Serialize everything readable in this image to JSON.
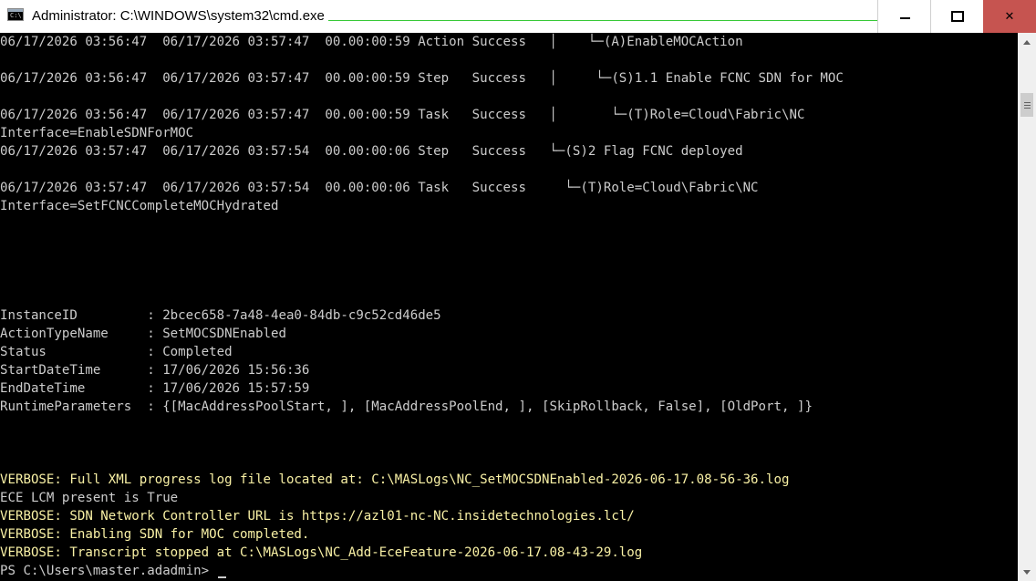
{
  "window": {
    "title": "Administrator: C:\\WINDOWS\\system32\\cmd.exe",
    "icon": "cmd-console-icon",
    "controls": {
      "minimize": "minimize-icon",
      "maximize": "maximize-icon",
      "close": "✕"
    },
    "close_color": "#c65450"
  },
  "colors": {
    "background": "#000000",
    "text": "#cccccc",
    "verbose": "#f9f1a5"
  },
  "console": {
    "lines": [
      "06/17/2026 03:56:47  06/17/2026 03:57:47  00.00:00:59 Action Success   │    └─(A)EnableMOCAction",
      "",
      "06/17/2026 03:56:47  06/17/2026 03:57:47  00.00:00:59 Step   Success   │     └─(S)1.1 Enable FCNC SDN for MOC",
      "",
      "06/17/2026 03:56:47  06/17/2026 03:57:47  00.00:00:59 Task   Success   │       └─(T)Role=Cloud\\Fabric\\NC",
      "Interface=EnableSDNForMOC",
      "06/17/2026 03:57:47  06/17/2026 03:57:54  00.00:00:06 Step   Success   └─(S)2 Flag FCNC deployed",
      "",
      "06/17/2026 03:57:47  06/17/2026 03:57:54  00.00:00:06 Task   Success     └─(T)Role=Cloud\\Fabric\\NC",
      "Interface=SetFCNCCompleteMOCHydrated",
      "",
      "",
      "",
      "",
      "",
      "InstanceID         : 2bcec658-7a48-4ea0-84db-c9c52cd46de5",
      "ActionTypeName     : SetMOCSDNEnabled",
      "Status             : Completed",
      "StartDateTime      : 17/06/2026 15:56:36",
      "EndDateTime        : 17/06/2026 15:57:59",
      "RuntimeParameters  : {[MacAddressPoolStart, ], [MacAddressPoolEnd, ], [SkipRollback, False], [OldPort, ]}",
      "",
      "",
      "",
      "VERBOSE: Full XML progress log file located at: C:\\MASLogs\\NC_SetMOCSDNEnabled-2026-06-17.08-56-36.log",
      "ECE LCM present is True",
      "VERBOSE: SDN Network Controller URL is https://azl01-nc-NC.insidetechnologies.lcl/",
      "VERBOSE: Enabling SDN for MOC completed.",
      "VERBOSE: Transcript stopped at C:\\MASLogs\\NC_Add-EceFeature-2026-06-17.08-43-29.log",
      "PS C:\\Users\\master.adadmin> "
    ]
  },
  "scrollbar": {
    "up": "scroll-up-icon",
    "down": "scroll-down-icon"
  }
}
